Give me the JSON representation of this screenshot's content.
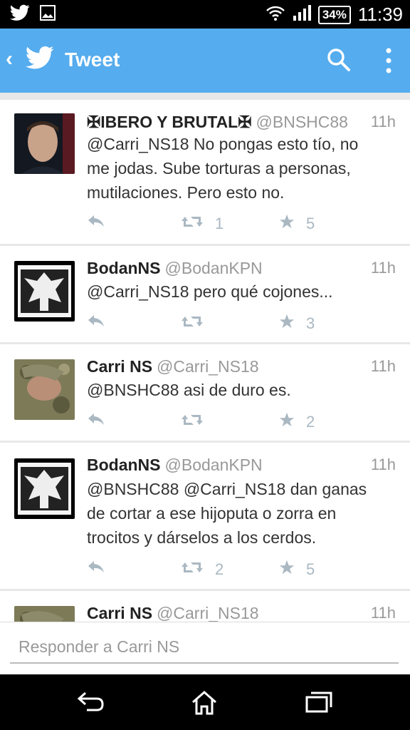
{
  "status_bar": {
    "battery": "34%",
    "time": "11:39"
  },
  "app_bar": {
    "title": "Tweet"
  },
  "tweets": [
    {
      "name": "✠IBERO Y BRUTAL✠",
      "handle": "@BNSHC88",
      "time": "11h",
      "lines": [
        "@Carri_NS18 No pongas esto tío, no",
        "me jodas. Sube torturas a personas,",
        "mutilaciones. Pero esto no."
      ],
      "retweets": "1",
      "favorites": "5"
    },
    {
      "name": "BodanNS",
      "handle": "@BodanKPN",
      "time": "11h",
      "lines": [
        "@Carri_NS18 pero qué cojones..."
      ],
      "retweets": "",
      "favorites": "3"
    },
    {
      "name": "Carri NS",
      "handle": "@Carri_NS18",
      "time": "11h",
      "lines": [
        "@BNSHC88 asi de duro es."
      ],
      "retweets": "",
      "favorites": "2"
    },
    {
      "name": "BodanNS",
      "handle": "@BodanKPN",
      "time": "11h",
      "lines": [
        "@BNSHC88 @Carri_NS18 dan ganas",
        "de cortar a ese hijoputa o zorra en",
        "trocitos y dárselos a los cerdos."
      ],
      "retweets": "2",
      "favorites": "5"
    },
    {
      "name": "Carri NS",
      "handle": "@Carri_NS18",
      "time": "11h"
    }
  ],
  "reply_box": {
    "placeholder": "Responder a Carri NS"
  },
  "colors": {
    "accent": "#55acee",
    "action_icon": "#aab8c2",
    "muted_text": "#999999"
  },
  "icons": [
    "twitter-icon",
    "image-icon",
    "wifi-icon",
    "signal-icon",
    "battery-icon",
    "back-icon",
    "twitter-bird-icon",
    "search-icon",
    "more-icon",
    "reply-icon",
    "retweet-icon",
    "star-icon",
    "nav-back-icon",
    "nav-home-icon",
    "nav-recents-icon"
  ]
}
